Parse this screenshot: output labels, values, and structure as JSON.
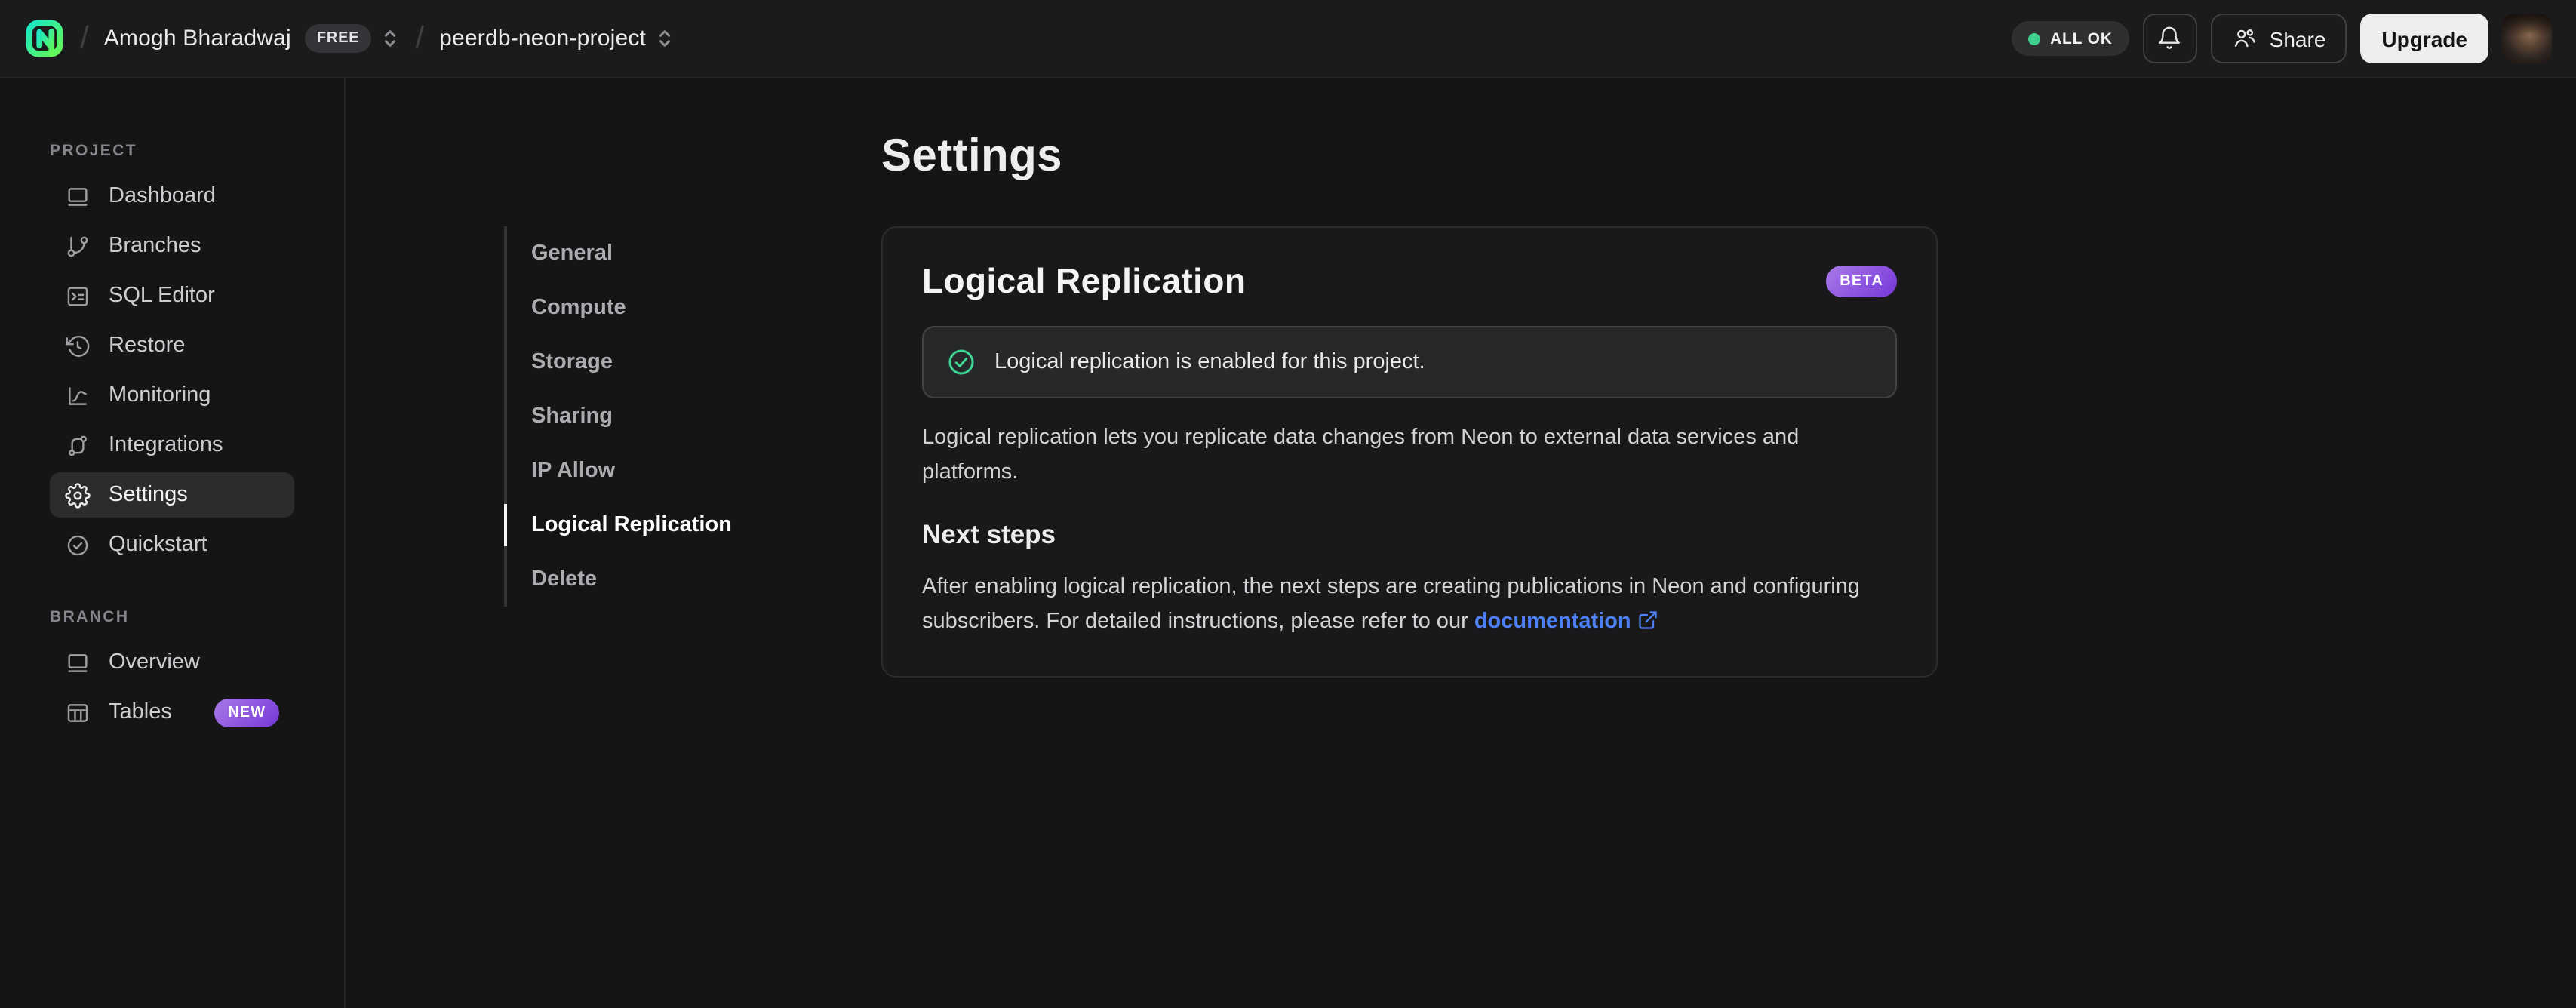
{
  "topbar": {
    "breadcrumb": {
      "org": "Amogh Bharadwaj",
      "org_badge": "FREE",
      "project": "peerdb-neon-project"
    },
    "status": "ALL OK",
    "share_label": "Share",
    "upgrade_label": "Upgrade"
  },
  "sidebar": {
    "sections": [
      {
        "label": "PROJECT",
        "items": [
          {
            "label": "Dashboard",
            "icon": "dashboard-icon"
          },
          {
            "label": "Branches",
            "icon": "branches-icon"
          },
          {
            "label": "SQL Editor",
            "icon": "sql-editor-icon"
          },
          {
            "label": "Restore",
            "icon": "restore-icon"
          },
          {
            "label": "Monitoring",
            "icon": "monitoring-icon"
          },
          {
            "label": "Integrations",
            "icon": "integrations-icon"
          },
          {
            "label": "Settings",
            "icon": "settings-icon",
            "active": true
          },
          {
            "label": "Quickstart",
            "icon": "quickstart-icon"
          }
        ]
      },
      {
        "label": "BRANCH",
        "items": [
          {
            "label": "Overview",
            "icon": "overview-icon"
          },
          {
            "label": "Tables",
            "icon": "tables-icon",
            "badge": "NEW"
          }
        ]
      }
    ]
  },
  "main": {
    "title": "Settings",
    "nav": [
      {
        "label": "General"
      },
      {
        "label": "Compute"
      },
      {
        "label": "Storage"
      },
      {
        "label": "Sharing"
      },
      {
        "label": "IP Allow"
      },
      {
        "label": "Logical Replication",
        "active": true
      },
      {
        "label": "Delete"
      }
    ],
    "card": {
      "title": "Logical Replication",
      "badge": "BETA",
      "alert": "Logical replication is enabled for this project.",
      "description": "Logical replication lets you replicate data changes from Neon to external data services and platforms.",
      "next_steps_title": "Next steps",
      "next_steps_text": "After enabling logical replication, the next steps are creating publications in Neon and configuring subscribers. For detailed instructions, please refer to our ",
      "link_label": "documentation"
    }
  },
  "colors": {
    "brand_green": "#63f655",
    "brand_teal": "#1be7c7",
    "status_green": "#3ecf8e",
    "success_green": "#3fd493",
    "badge_purple_from": "#a97ae8",
    "badge_purple_to": "#7637d8",
    "link_blue": "#4d80f6"
  }
}
